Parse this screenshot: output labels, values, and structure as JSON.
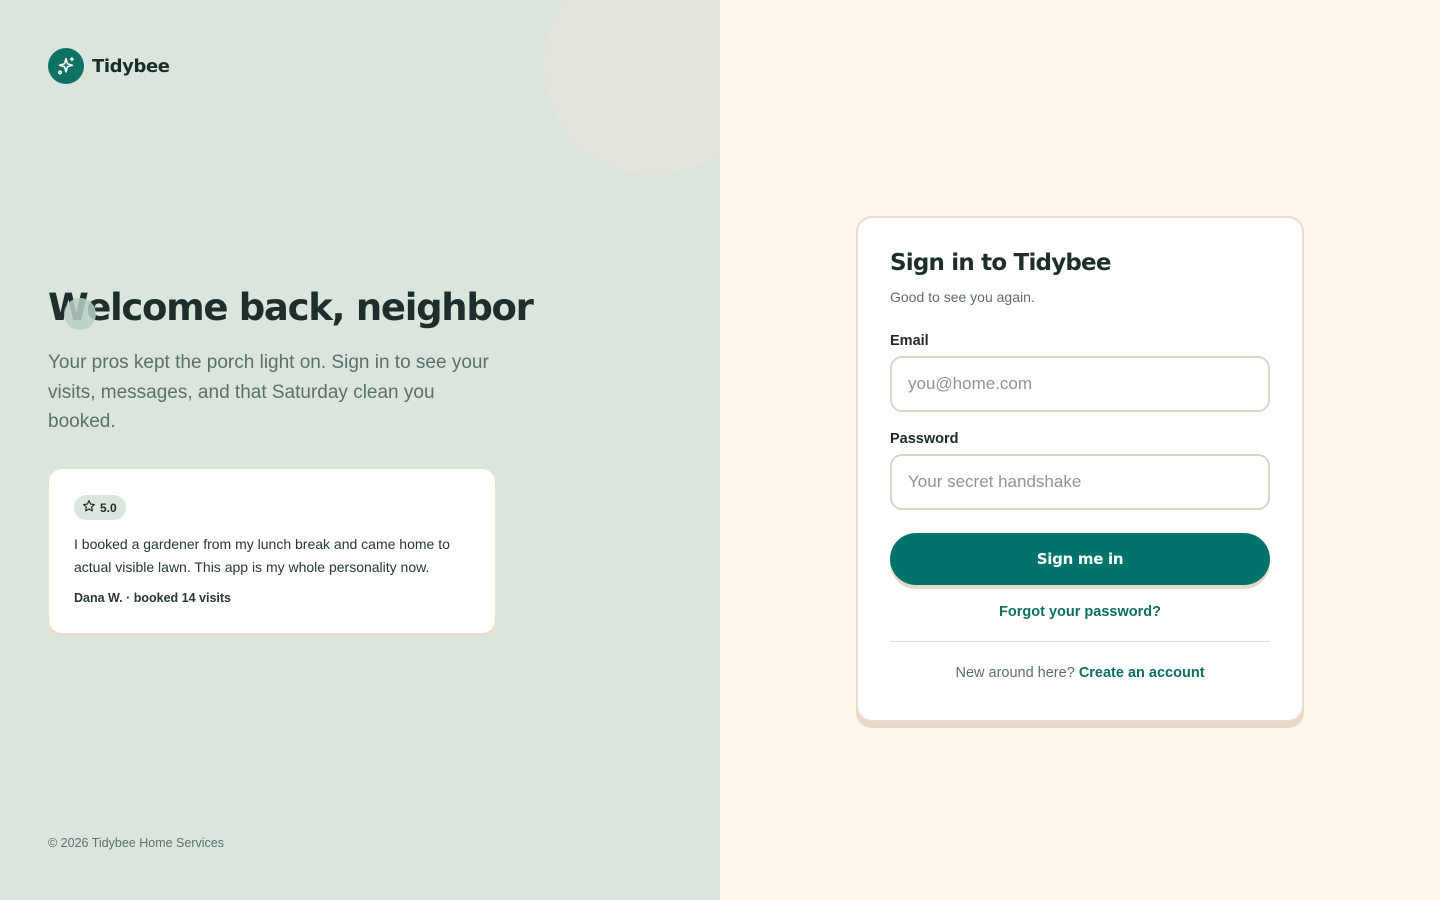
{
  "brand": {
    "name": "Tidybee",
    "icon": "sparkle-icon",
    "color": "#0d7264"
  },
  "hero": {
    "title": "Welcome back, neighbor",
    "subtitle": "Your pros kept the porch light on. Sign in to see your visits, messages, and that Saturday clean you booked."
  },
  "review": {
    "rating": "5.0",
    "rating_icon": "star-icon",
    "text": "I booked a gardener from my lunch break and came home to actual visible lawn. This app is my whole personality now.",
    "author": "Dana W. · booked 14 visits"
  },
  "footer": {
    "copyright": "© 2026 Tidybee Home Services"
  },
  "signin": {
    "title": "Sign in to Tidybee",
    "subtitle": "Good to see you again.",
    "email": {
      "label": "Email",
      "placeholder": "you@home.com",
      "value": ""
    },
    "password": {
      "label": "Password",
      "placeholder": "Your secret handshake",
      "value": ""
    },
    "submit_label": "Sign me in",
    "forgot_label": "Forgot your password?",
    "signup_prompt": "New around here?",
    "signup_label": "Create an account"
  },
  "colors": {
    "accent": "#00746a",
    "left_background": "#dae5dc",
    "right_background": "#fef6ec"
  }
}
